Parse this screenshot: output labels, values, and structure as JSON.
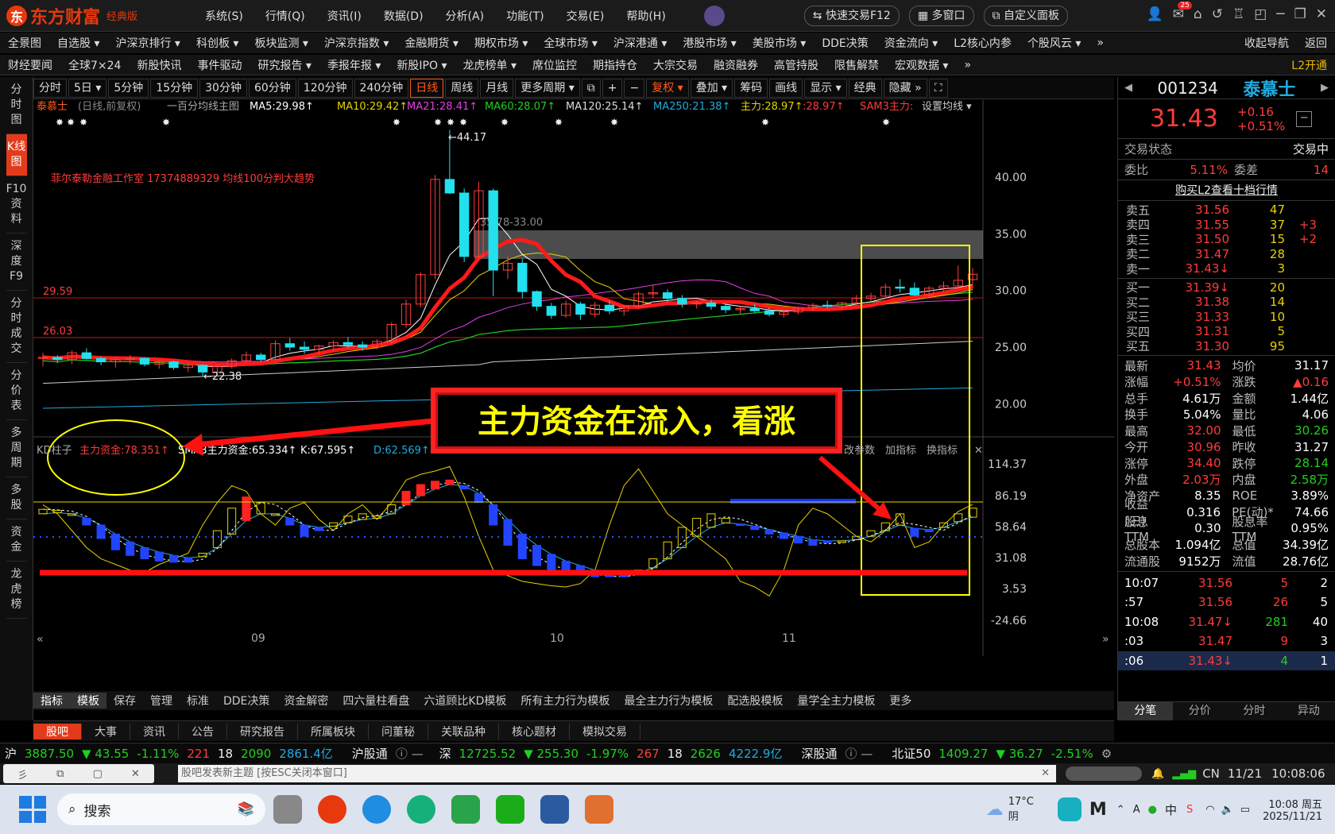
{
  "app": {
    "logo_glyph": "东",
    "name": "东方财富",
    "edition": "经典版"
  },
  "top_menu": [
    "系统(S)",
    "行情(Q)",
    "资讯(I)",
    "数据(D)",
    "分析(A)",
    "功能(T)",
    "交易(E)",
    "帮助(H)"
  ],
  "top_buttons": {
    "fast_trade": "快速交易F12",
    "multi_window": "多窗口",
    "custom_panel": "自定义面板",
    "mail_badge": "25"
  },
  "nav_row1": [
    "全景图",
    "自选股 ▾",
    "沪深京排行 ▾",
    "科创板 ▾",
    "板块监测 ▾",
    "沪深京指数 ▾",
    "金融期货 ▾",
    "期权市场 ▾",
    "全球市场 ▾",
    "沪深港通 ▾",
    "港股市场 ▾",
    "美股市场 ▾",
    "DDE决策",
    "资金流向 ▾",
    "L2核心内参",
    "个股风云 ▾",
    "»",
    "收起导航",
    "返回"
  ],
  "nav_row2": [
    "财经要闻",
    "全球7×24",
    "新股快讯",
    "事件驱动",
    "研究报告 ▾",
    "季报年报 ▾",
    "新股IPO ▾",
    "龙虎榜单 ▾",
    "席位监控",
    "期指持仓",
    "大宗交易",
    "融资融券",
    "高管持股",
    "限售解禁",
    "宏观数据 ▾",
    "»",
    "L2开通"
  ],
  "left_tabs": [
    "分时图",
    "K线图",
    "F10资料",
    "深度F9",
    "分时成交",
    "分价表",
    "多周期",
    "多股",
    "资金",
    "龙虎榜"
  ],
  "left_active": "K线图",
  "chart_toolbar": [
    "分时",
    "5日 ▾",
    "5分钟",
    "15分钟",
    "30分钟",
    "60分钟",
    "120分钟",
    "240分钟",
    "日线",
    "周线",
    "月线",
    "更多周期 ▾",
    "⧉",
    "+",
    "−",
    "复权 ▾",
    "叠加 ▾",
    "筹码",
    "画线",
    "显示 ▾",
    "经典",
    "隐藏 »",
    "⛶"
  ],
  "chart_toolbar_active": "日线",
  "chart_legend": {
    "name": "泰慕士",
    "mode": "(日线,前复权)",
    "tpl": "一百分均线主图",
    "items": [
      {
        "t": "MA5:29.98↑",
        "c": "#ffffff"
      },
      {
        "t": "MA10:29.42↑",
        "c": "#e6d200"
      },
      {
        "t": "MA21:28.41↑",
        "c": "#e040e0"
      },
      {
        "t": "MA60:28.07↑",
        "c": "#20d020"
      },
      {
        "t": "MA120:25.14↑",
        "c": "#dddddd"
      },
      {
        "t": "MA250:21.38↑",
        "c": "#22aadd"
      },
      {
        "t": "主力:28.97↑",
        "c": "#e6d200"
      },
      {
        "t": ":28.97↑",
        "c": "#ff3b3b"
      },
      {
        "t": "SAM3主力:",
        "c": "#ff3b3b"
      }
    ],
    "settings": "设置均线 ▾"
  },
  "chart_watermark": "菲尔泰勒金融工作室 17374889329 均线100分判大趋势",
  "chart_annotations": {
    "high": "←44.17",
    "low": "←22.38",
    "zone": "35.78-33.00",
    "level1": "29.59",
    "level2": "26.03",
    "callout": "主力资金在流入，看涨"
  },
  "indicator_legend": {
    "name": "KD柱子",
    "items": [
      {
        "t": "主力资金:78.351↑",
        "c": "#ff3b3b"
      },
      {
        "t": "SMA3主力资金:65.334↑",
        "c": "#ffffff"
      },
      {
        "t": "K:67.595↑",
        "c": "#ffffff"
      },
      {
        "t": "D:62.569↑",
        "c": "#20aadd"
      }
    ],
    "right": [
      "改参数",
      "加指标",
      "换指标"
    ]
  },
  "chart_data": {
    "type": "candlestick",
    "price_axis": {
      "ticks": [
        20,
        25,
        30,
        35,
        40
      ],
      "range": [
        17.5,
        44.7
      ]
    },
    "indicator_axis": {
      "ticks": [
        114.37,
        86.19,
        58.64,
        31.08,
        3.53,
        -24.66
      ]
    },
    "x_labels": [
      "09",
      "10",
      "11"
    ],
    "ma250": [
      19.6,
      21.4
    ],
    "candles": [
      [
        24.0,
        24.5,
        23.3,
        24.1
      ],
      [
        24.1,
        24.3,
        23.6,
        23.9
      ],
      [
        23.9,
        24.7,
        23.5,
        24.5
      ],
      [
        24.5,
        24.9,
        23.9,
        24.0
      ],
      [
        24.0,
        24.2,
        23.4,
        23.7
      ],
      [
        23.7,
        24.1,
        23.2,
        23.9
      ],
      [
        23.9,
        24.3,
        23.5,
        24.0
      ],
      [
        24.0,
        24.1,
        23.3,
        23.5
      ],
      [
        23.5,
        23.9,
        23.1,
        23.7
      ],
      [
        23.7,
        23.8,
        23.0,
        23.2
      ],
      [
        23.2,
        23.6,
        22.8,
        23.4
      ],
      [
        23.4,
        23.5,
        22.38,
        22.8
      ],
      [
        22.8,
        23.5,
        22.7,
        23.3
      ],
      [
        23.3,
        24.0,
        23.1,
        23.8
      ],
      [
        23.8,
        24.6,
        23.6,
        24.3
      ],
      [
        24.3,
        24.5,
        23.7,
        23.9
      ],
      [
        23.9,
        25.6,
        23.8,
        25.3
      ],
      [
        25.3,
        25.8,
        24.7,
        25.0
      ],
      [
        25.0,
        25.5,
        24.4,
        24.8
      ],
      [
        24.8,
        25.2,
        24.3,
        25.1
      ],
      [
        25.1,
        25.6,
        24.7,
        25.4
      ],
      [
        25.4,
        25.9,
        24.9,
        25.2
      ],
      [
        25.2,
        25.5,
        24.7,
        25.0
      ],
      [
        25.0,
        25.7,
        24.8,
        25.5
      ],
      [
        25.5,
        27.2,
        25.3,
        27.0
      ],
      [
        27.0,
        29.2,
        26.7,
        28.8
      ],
      [
        28.8,
        31.6,
        28.5,
        31.4
      ],
      [
        31.4,
        40.2,
        31.0,
        39.8
      ],
      [
        39.8,
        44.17,
        38.5,
        38.6
      ],
      [
        38.6,
        39.0,
        32.5,
        33.0
      ],
      [
        33.0,
        39.6,
        32.8,
        38.8
      ],
      [
        38.8,
        39.0,
        29.5,
        31.8
      ],
      [
        31.8,
        33.0,
        31.0,
        32.4
      ],
      [
        32.4,
        32.8,
        29.3,
        29.9
      ],
      [
        29.9,
        30.0,
        28.2,
        28.6
      ],
      [
        28.6,
        28.9,
        27.5,
        27.8
      ],
      [
        27.8,
        29.1,
        27.6,
        28.8
      ],
      [
        28.8,
        29.0,
        27.4,
        27.9
      ],
      [
        27.9,
        29.0,
        27.6,
        28.7
      ],
      [
        28.7,
        29.1,
        27.9,
        28.2
      ],
      [
        28.2,
        28.7,
        27.8,
        28.6
      ],
      [
        28.6,
        29.9,
        28.4,
        29.7
      ],
      [
        29.7,
        30.5,
        29.3,
        29.8
      ],
      [
        29.8,
        30.1,
        29.0,
        29.3
      ],
      [
        29.3,
        29.6,
        28.5,
        28.8
      ],
      [
        28.8,
        29.1,
        28.4,
        28.9
      ],
      [
        28.9,
        29.2,
        28.3,
        28.6
      ],
      [
        28.6,
        28.8,
        28.0,
        28.3
      ],
      [
        28.3,
        28.6,
        27.9,
        28.4
      ],
      [
        28.4,
        28.8,
        28.0,
        28.2
      ],
      [
        28.2,
        28.5,
        27.7,
        27.9
      ],
      [
        27.9,
        28.3,
        27.6,
        28.1
      ],
      [
        28.1,
        28.6,
        27.9,
        28.5
      ],
      [
        28.5,
        28.9,
        28.2,
        28.7
      ],
      [
        28.7,
        29.1,
        28.4,
        28.6
      ],
      [
        28.6,
        29.0,
        28.3,
        28.9
      ],
      [
        28.9,
        29.6,
        28.7,
        29.3
      ],
      [
        29.3,
        29.8,
        29.0,
        29.5
      ],
      [
        29.5,
        30.6,
        29.3,
        30.3
      ],
      [
        30.3,
        31.0,
        29.8,
        30.2
      ],
      [
        30.2,
        30.7,
        29.5,
        29.6
      ],
      [
        29.6,
        30.4,
        29.4,
        30.2
      ],
      [
        30.2,
        30.8,
        29.9,
        30.4
      ],
      [
        30.4,
        32.2,
        30.2,
        30.9
      ],
      [
        30.96,
        32.0,
        30.26,
        31.43
      ]
    ],
    "kd_k": [
      74,
      73,
      70,
      60,
      48,
      38,
      33,
      30,
      28,
      27,
      27,
      35,
      55,
      75,
      85,
      80,
      70,
      60,
      50,
      55,
      62,
      68,
      70,
      68,
      78,
      90,
      96,
      99,
      100,
      92,
      80,
      60,
      42,
      30,
      24,
      20,
      18,
      16,
      14,
      14,
      14,
      20,
      30,
      45,
      58,
      66,
      70,
      66,
      60,
      56,
      52,
      48,
      44,
      42,
      44,
      46,
      50,
      55,
      62,
      70,
      50,
      54,
      62,
      70,
      75
    ],
    "kd_d": [
      70,
      71,
      70,
      66,
      60,
      52,
      45,
      40,
      36,
      33,
      31,
      32,
      40,
      52,
      64,
      70,
      70,
      66,
      60,
      58,
      59,
      62,
      65,
      66,
      70,
      78,
      86,
      92,
      96,
      95,
      88,
      78,
      65,
      52,
      42,
      34,
      28,
      24,
      20,
      18,
      17,
      18,
      22,
      30,
      40,
      50,
      58,
      62,
      61,
      59,
      56,
      53,
      50,
      47,
      46,
      46,
      47,
      50,
      55,
      60,
      57,
      56,
      58,
      63,
      67
    ],
    "main_money": [
      78,
      70,
      55,
      40,
      30,
      25,
      20,
      18,
      25,
      30,
      35,
      60,
      80,
      95,
      90,
      70,
      60,
      75,
      80,
      65,
      55,
      70,
      78,
      65,
      80,
      100,
      105,
      108,
      112,
      85,
      50,
      20,
      15,
      10,
      8,
      6,
      5,
      8,
      20,
      60,
      95,
      110,
      90,
      70,
      60,
      50,
      40,
      30,
      10,
      5,
      -3,
      20,
      60,
      75,
      70,
      60,
      50,
      45,
      55,
      70,
      40,
      45,
      60,
      72,
      78.35
    ]
  },
  "callout_text": "主力资金在流入，看涨",
  "bottom_tabs": [
    "指标",
    "模板",
    "保存",
    "管理",
    "标准",
    "DDE决策",
    "资金解密",
    "四六量柱看盘",
    "六道顾比KD模板",
    "所有主力行为模板",
    "最全主力行为模板",
    "配选股模板",
    "量学全主力模板",
    "更多"
  ],
  "bottom_tabs_active": [
    "指标",
    "模板"
  ],
  "news_tabs": [
    "股吧",
    "大事",
    "资讯",
    "公告",
    "研究报告",
    "所属板块",
    "问董秘",
    "关联品种",
    "核心题材",
    "模拟交易"
  ],
  "stock": {
    "code": "001234",
    "name": "泰慕士",
    "price": "31.43",
    "change": "+0.16",
    "pct": "+0.51%",
    "status_label": "交易状态",
    "status": "交易中",
    "webi_label": "委比",
    "webi": "5.11%",
    "weicha_label": "委差",
    "weicha": "14",
    "l2_link": "购买L2查看十档行情",
    "asks": [
      [
        "卖五",
        "31.56",
        "47",
        ""
      ],
      [
        "卖四",
        "31.55",
        "37",
        "+3"
      ],
      [
        "卖三",
        "31.50",
        "15",
        "+2"
      ],
      [
        "卖二",
        "31.47",
        "28",
        ""
      ],
      [
        "卖一",
        "31.43↓",
        "3",
        ""
      ]
    ],
    "bids": [
      [
        "买一",
        "31.39↓",
        "20",
        ""
      ],
      [
        "买二",
        "31.38",
        "14",
        ""
      ],
      [
        "买三",
        "31.33",
        "10",
        ""
      ],
      [
        "买四",
        "31.31",
        "5",
        ""
      ],
      [
        "买五",
        "31.30",
        "95",
        ""
      ]
    ],
    "stats": [
      [
        "最新",
        "31.43",
        "均价",
        "31.17"
      ],
      [
        "涨幅",
        "+0.51%",
        "涨跌",
        "▲0.16"
      ],
      [
        "总手",
        "4.61万",
        "金额",
        "1.44亿"
      ],
      [
        "换手",
        "5.04%",
        "量比",
        "4.06"
      ],
      [
        "最高",
        "32.00",
        "最低",
        "30.26"
      ],
      [
        "今开",
        "30.96",
        "昨收",
        "31.27"
      ],
      [
        "涨停",
        "34.40",
        "跌停",
        "28.14"
      ],
      [
        "外盘",
        "2.03万",
        "内盘",
        "2.58万"
      ],
      [
        "净资产",
        "8.35",
        "ROE",
        "3.89%"
      ],
      [
        "收益(三)",
        "0.316",
        "PE(动)*",
        "74.66"
      ],
      [
        "股息TTM",
        "0.30",
        "股息率TTM",
        "0.95%"
      ],
      [
        "总股本",
        "1.094亿",
        "总值",
        "34.39亿"
      ],
      [
        "流通股",
        "9152万",
        "流值",
        "28.76亿"
      ]
    ],
    "trades": [
      [
        "10:07",
        "31.56",
        "5",
        "2"
      ],
      [
        ":57",
        "31.56",
        "26",
        "5"
      ],
      [
        "10:08",
        "31.47↓",
        "281",
        "40"
      ],
      [
        ":03",
        "31.47",
        "9",
        "3"
      ],
      [
        ":06",
        "31.43↓",
        "4",
        "1"
      ]
    ],
    "panel_tabs": [
      "分笔",
      "分价",
      "分时",
      "异动"
    ]
  },
  "ticker": {
    "sh_label": "沪",
    "sh": "3887.50",
    "sh_chg": "▼ 43.55",
    "sh_pct": "-1.11%",
    "sh_up": "221",
    "sh_flat": "18",
    "sh_down": "2090",
    "sh_amt": "2861.4亿",
    "hgt": "沪股通",
    "sz_label": "深",
    "sz": "12725.52",
    "sz_chg": "▼ 255.30",
    "sz_pct": "-1.97%",
    "sz_up": "267",
    "sz_flat": "18",
    "sz_down": "2626",
    "sz_amt": "4222.9亿",
    "sgt": "深股通",
    "bz_label": "北证50",
    "bz": "1409.27",
    "bz_chg": "▼ 36.27",
    "bz_pct": "-2.51%"
  },
  "status": {
    "post_hint": "股吧发表新主题 [按ESC关闭本窗口]",
    "lang": "CN",
    "date": "11/21",
    "time": "10:08:06"
  },
  "taskbar": {
    "search": "搜索",
    "weather_temp": "17°C",
    "weather_desc": "阴",
    "ime": "中",
    "clock_time": "10:08 周五",
    "clock_date": "2025/11/21"
  }
}
